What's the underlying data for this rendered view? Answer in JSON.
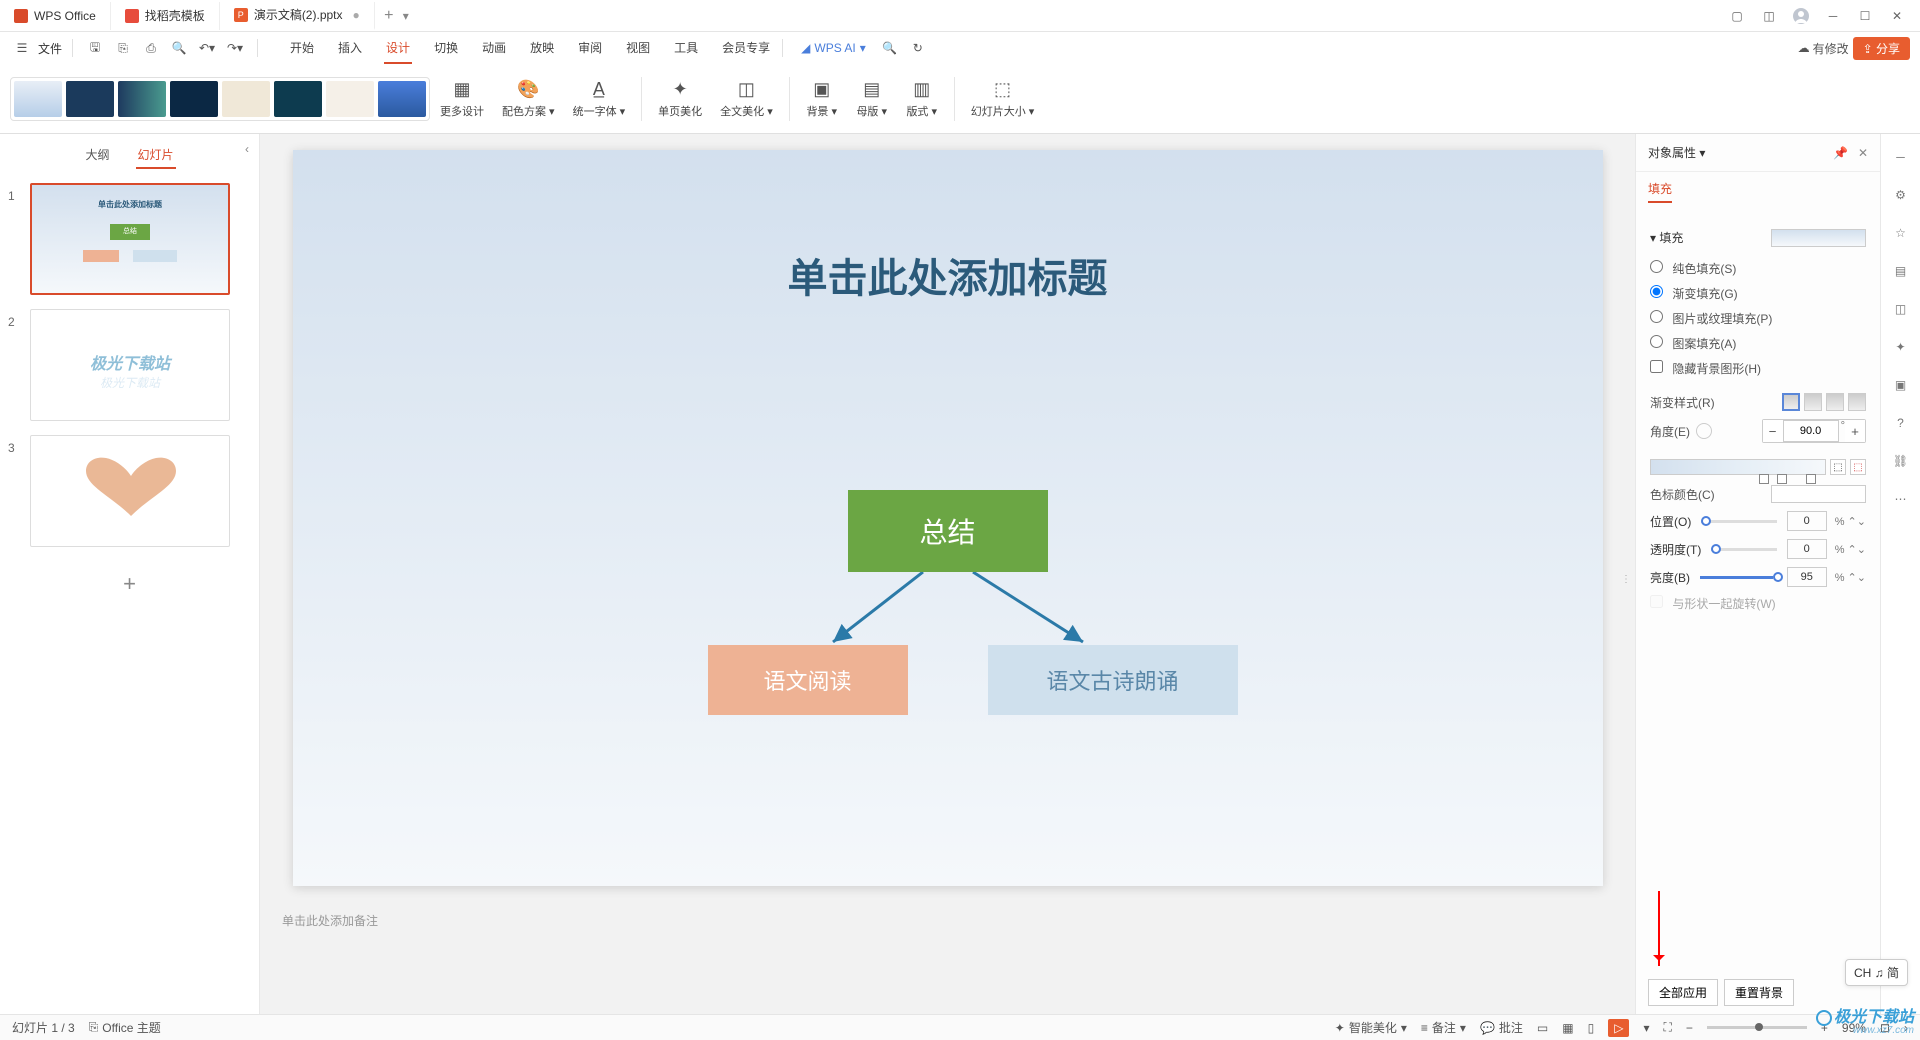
{
  "tabs": {
    "wps": "WPS Office",
    "docer": "找稻壳模板",
    "ppt": "演示文稿(2).pptx"
  },
  "qa": {
    "file": "文件"
  },
  "menu": {
    "start": "开始",
    "insert": "插入",
    "design": "设计",
    "transition": "切换",
    "animation": "动画",
    "slideshow": "放映",
    "review": "审阅",
    "view": "视图",
    "tools": "工具",
    "member": "会员专享",
    "wpsai": "WPS AI"
  },
  "topright": {
    "changes": "有修改",
    "share": "分享"
  },
  "ribbon": {
    "more_design": "更多设计",
    "color_scheme": "配色方案",
    "unify_font": "统一字体",
    "page_beautify": "单页美化",
    "doc_beautify": "全文美化",
    "background": "背景",
    "master": "母版",
    "layout": "版式",
    "slide_size": "幻灯片大小"
  },
  "thumbs_panel": {
    "outline": "大纲",
    "slides": "幻灯片"
  },
  "slides": [
    1,
    2,
    3
  ],
  "canvas": {
    "title_placeholder": "单击此处添加标题",
    "box_summary": "总结",
    "box_reading": "语文阅读",
    "box_poetry": "语文古诗朗诵",
    "notes_placeholder": "单击此处添加备注"
  },
  "thumb1": {
    "title": "单击此处添加标题",
    "summary": "总结"
  },
  "thumb2": {
    "text": "极光下载站"
  },
  "prop": {
    "title": "对象属性",
    "tab_fill": "填充",
    "sec_fill": "填充",
    "solid": "纯色填充(S)",
    "gradient": "渐变填充(G)",
    "picture": "图片或纹理填充(P)",
    "pattern": "图案填充(A)",
    "hidebg": "隐藏背景图形(H)",
    "grad_style": "渐变样式(R)",
    "angle": "角度(E)",
    "angle_val": "90.0",
    "stop_color": "色标颜色(C)",
    "position": "位置(O)",
    "position_val": "0",
    "transparency": "透明度(T)",
    "transparency_val": "0",
    "brightness": "亮度(B)",
    "brightness_val": "95",
    "rotate_with": "与形状一起旋转(W)",
    "apply_all": "全部应用",
    "reset_bg": "重置背景"
  },
  "status": {
    "slide_counter": "幻灯片 1 / 3",
    "theme": "Office 主题",
    "smart_beautify": "智能美化",
    "notes": "备注",
    "comments": "批注",
    "zoom_val": "99%"
  },
  "ime": "CH ♫ 简",
  "watermark": {
    "main": "极光下载站",
    "sub": "www.xz7.com"
  }
}
